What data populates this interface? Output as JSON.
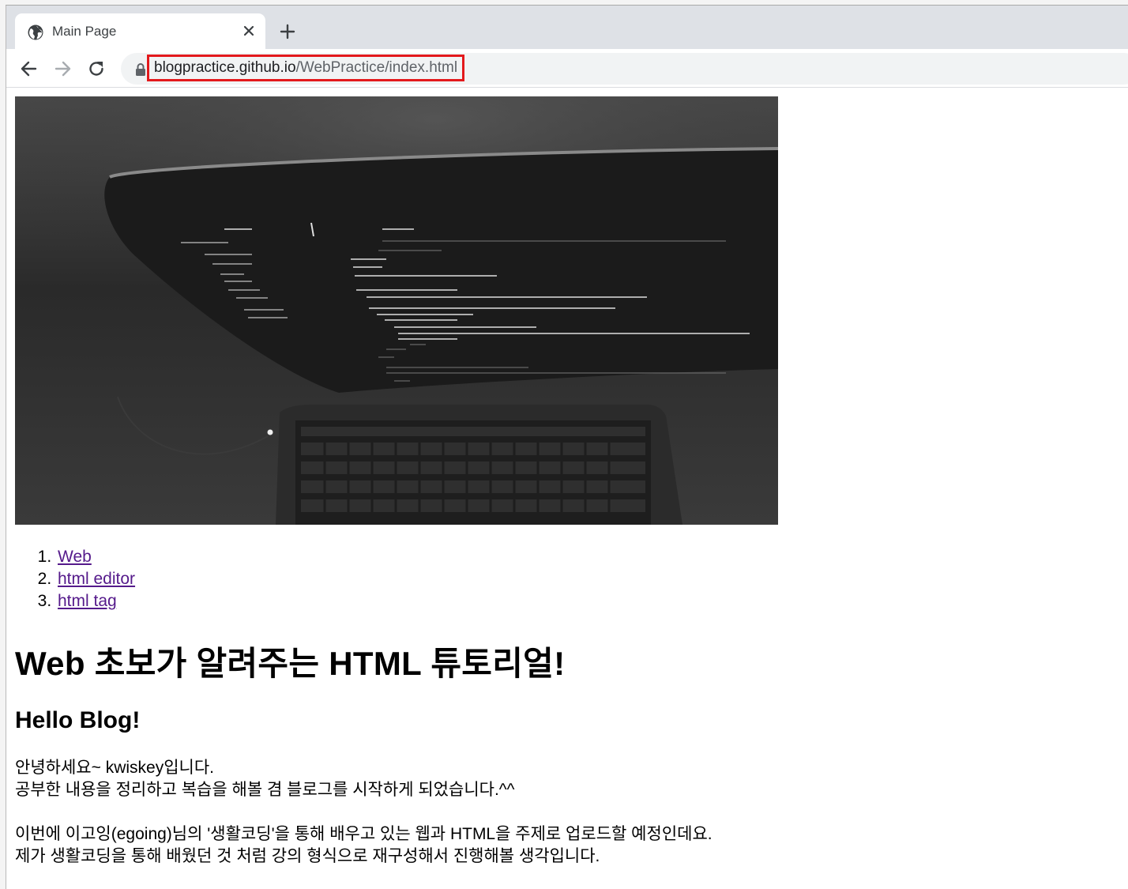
{
  "browser": {
    "tab": {
      "title": "Main Page"
    },
    "address": {
      "host": "blogpractice.github.io",
      "path": "/WebPractice/index.html",
      "highlight_color": "#e3191c"
    }
  },
  "page": {
    "hero_image": {
      "description": "laptop-with-code"
    },
    "nav": [
      {
        "label": "Web"
      },
      {
        "label": "html editor"
      },
      {
        "label": "html tag"
      }
    ],
    "heading": "Web 초보가 알려주는 HTML 튜토리얼!",
    "subheading": "Hello Blog!",
    "paragraphs": [
      [
        "안녕하세요~ kwiskey입니다.",
        "공부한 내용을 정리하고 복습을 해볼 겸 블로그를 시작하게 되었습니다.^^"
      ],
      [
        "이번에 이고잉(egoing)님의 '생활코딩'을 통해 배우고 있는 웹과 HTML을 주제로 업로드할 예정인데요.",
        "제가 생활코딩을 통해 배웠던 것 처럼 강의 형식으로 재구성해서 진행해볼 생각입니다."
      ]
    ],
    "link_color": "#551a8b"
  }
}
